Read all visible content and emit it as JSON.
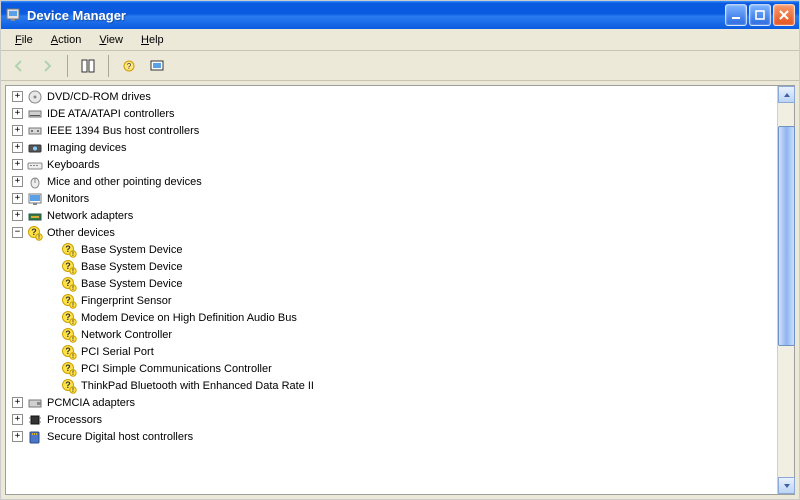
{
  "window": {
    "title": "Device Manager"
  },
  "menu": {
    "file": "File",
    "action": "Action",
    "view": "View",
    "help": "Help"
  },
  "toolbar": {
    "back": "Back",
    "forward": "Forward",
    "properties": "Properties",
    "refresh": "Refresh",
    "scan": "Scan for hardware changes"
  },
  "tree": {
    "nodes": [
      {
        "icon": "disc",
        "expanded": false,
        "collapsible": true,
        "label": "DVD/CD-ROM drives"
      },
      {
        "icon": "ide",
        "expanded": false,
        "collapsible": true,
        "label": "IDE ATA/ATAPI controllers"
      },
      {
        "icon": "ieee",
        "expanded": false,
        "collapsible": true,
        "label": "IEEE 1394 Bus host controllers"
      },
      {
        "icon": "imaging",
        "expanded": false,
        "collapsible": true,
        "label": "Imaging devices"
      },
      {
        "icon": "keyboard",
        "expanded": false,
        "collapsible": true,
        "label": "Keyboards"
      },
      {
        "icon": "mouse",
        "expanded": false,
        "collapsible": true,
        "label": "Mice and other pointing devices"
      },
      {
        "icon": "monitor",
        "expanded": false,
        "collapsible": true,
        "label": "Monitors"
      },
      {
        "icon": "network",
        "expanded": false,
        "collapsible": true,
        "label": "Network adapters"
      },
      {
        "icon": "unknown",
        "expanded": true,
        "collapsible": true,
        "label": "Other devices",
        "children": [
          {
            "icon": "unknown",
            "label": "Base System Device"
          },
          {
            "icon": "unknown",
            "label": "Base System Device"
          },
          {
            "icon": "unknown",
            "label": "Base System Device"
          },
          {
            "icon": "unknown",
            "label": "Fingerprint Sensor"
          },
          {
            "icon": "unknown",
            "label": "Modem Device on High Definition Audio Bus"
          },
          {
            "icon": "unknown",
            "label": "Network Controller"
          },
          {
            "icon": "unknown",
            "label": "PCI Serial Port"
          },
          {
            "icon": "unknown",
            "label": "PCI Simple Communications Controller"
          },
          {
            "icon": "unknown",
            "label": "ThinkPad Bluetooth with Enhanced Data Rate II"
          }
        ]
      },
      {
        "icon": "pcmcia",
        "expanded": false,
        "collapsible": true,
        "label": "PCMCIA adapters"
      },
      {
        "icon": "cpu",
        "expanded": false,
        "collapsible": true,
        "label": "Processors"
      },
      {
        "icon": "sd",
        "expanded": false,
        "collapsible": true,
        "label": "Secure Digital host controllers"
      }
    ]
  }
}
